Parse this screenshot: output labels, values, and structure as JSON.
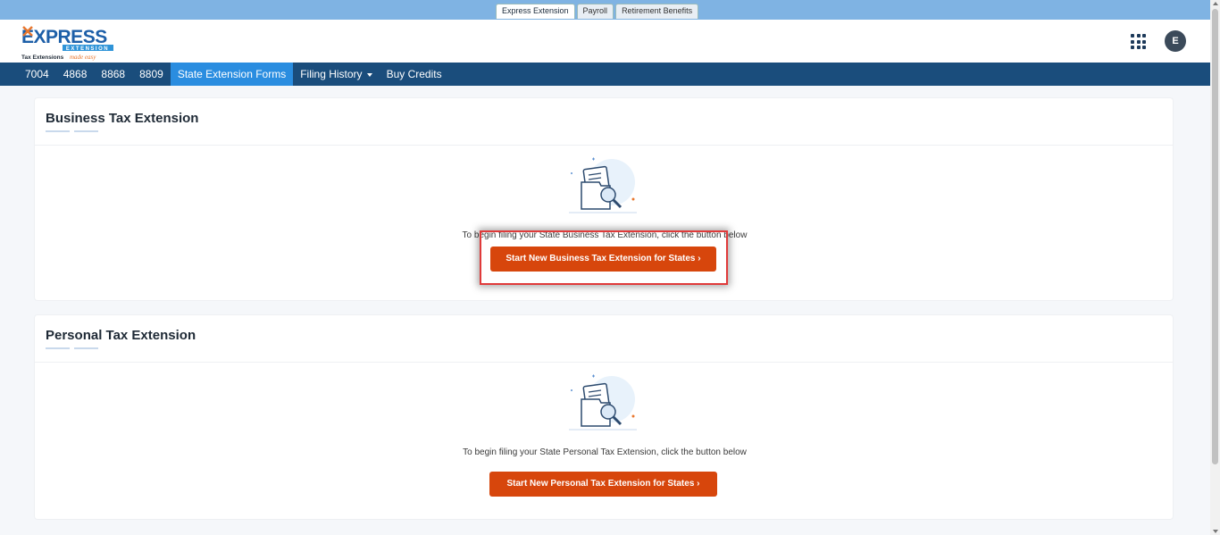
{
  "top_tabs": [
    "Express Extension",
    "Payroll",
    "Retirement Benefits"
  ],
  "logo": {
    "name": "EXPRESS",
    "sub": "EXTENSION",
    "tagline": "Tax Extensions",
    "tagline_script": "made easy"
  },
  "user_initial": "E",
  "nav": [
    "7004",
    "4868",
    "8868",
    "8809",
    "State Extension Forms",
    "Filing History",
    "Buy Credits"
  ],
  "business": {
    "title": "Business Tax Extension",
    "message": "To begin filing your State Business Tax Extension, click the button below",
    "button": "Start New Business Tax Extension for States ›"
  },
  "personal": {
    "title": "Personal Tax Extension",
    "message": "To begin filing your State Personal Tax Extension, click the button below",
    "button": "Start New Personal Tax Extension for States ›"
  },
  "colors": {
    "nav": "#1a4d7c",
    "nav_active": "#2a8de0",
    "button": "#d7460c",
    "highlight": "#e03a3a"
  }
}
